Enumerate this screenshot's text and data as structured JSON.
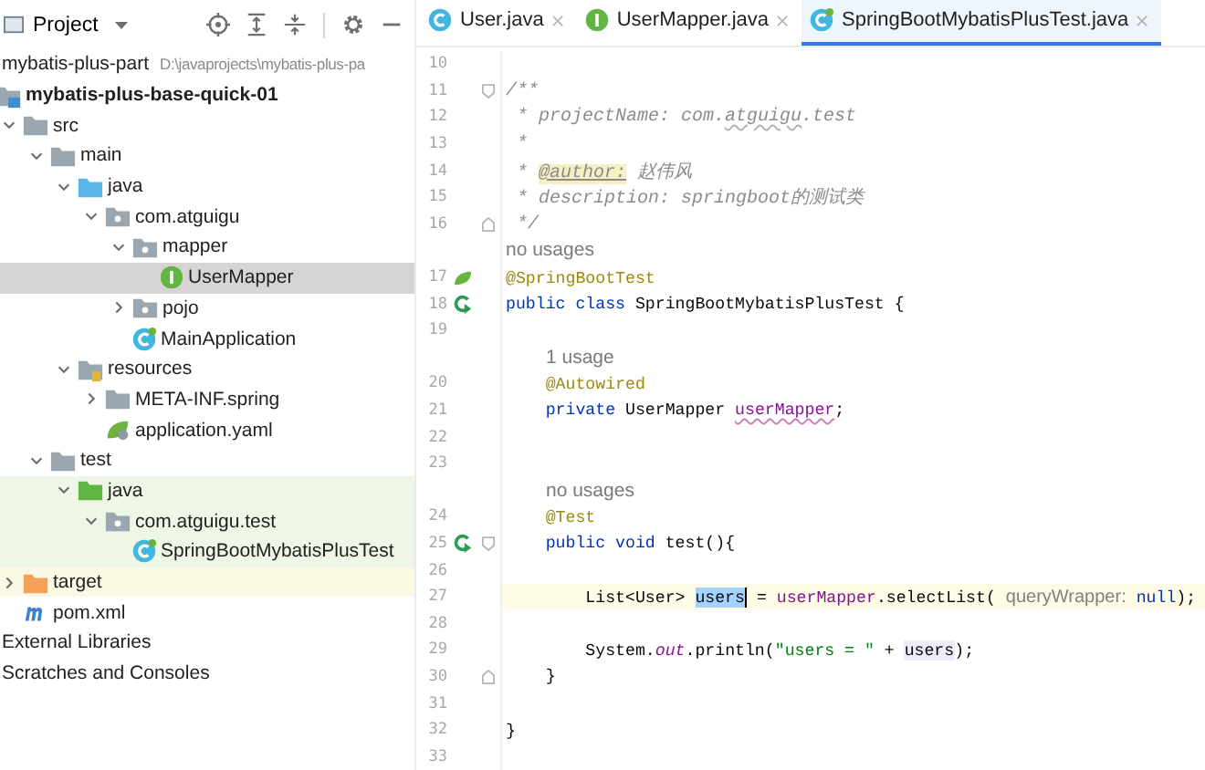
{
  "project_panel": {
    "title": "Project",
    "toolbar": [
      {
        "kind": "locate"
      },
      {
        "kind": "expand-all"
      },
      {
        "kind": "collapse-all"
      },
      {
        "kind": "settings"
      },
      {
        "kind": "hide"
      }
    ]
  },
  "tree": [
    {
      "label": "mybatis-plus-part",
      "path": "D:\\javaprojects\\mybatis-plus-pa",
      "selected": false,
      "children": [
        {
          "label": "mybatis-plus-base-quick-01",
          "kind": "module",
          "bold": true,
          "selected": false,
          "children": [
            {
              "label": "src",
              "kind": "folder",
              "expanded": true,
              "selected": false,
              "children": [
                {
                  "label": "main",
                  "kind": "folder",
                  "expanded": true,
                  "selected": false,
                  "children": [
                    {
                      "label": "java",
                      "kind": "source-folder",
                      "expanded": true,
                      "selected": false,
                      "children": [
                        {
                          "label": "com.atguigu",
                          "kind": "package",
                          "expanded": true,
                          "selected": false,
                          "children": [
                            {
                              "label": "mapper",
                              "kind": "package",
                              "expanded": true,
                              "selected": false,
                              "children": [
                                {
                                  "label": "UserMapper",
                                  "kind": "interface",
                                  "selected": true
                                }
                              ]
                            },
                            {
                              "label": "pojo",
                              "kind": "package",
                              "expanded": false,
                              "selected": false
                            },
                            {
                              "label": "MainApplication",
                              "kind": "spring-class",
                              "selected": false
                            }
                          ]
                        }
                      ]
                    },
                    {
                      "label": "resources",
                      "kind": "resources",
                      "expanded": true,
                      "selected": false,
                      "children": [
                        {
                          "label": "META-INF.spring",
                          "kind": "folder",
                          "expanded": false,
                          "selected": false
                        },
                        {
                          "label": "application.yaml",
                          "kind": "yaml",
                          "selected": false
                        }
                      ]
                    }
                  ]
                },
                {
                  "label": "test",
                  "kind": "folder",
                  "expanded": true,
                  "selected": false,
                  "children": [
                    {
                      "label": "java",
                      "kind": "test-folder",
                      "expanded": true,
                      "selected": false,
                      "test_scope": true,
                      "children": [
                        {
                          "label": "com.atguigu.test",
                          "kind": "package",
                          "expanded": true,
                          "selected": false,
                          "test_scope": true,
                          "children": [
                            {
                              "label": "SpringBootMybatisPlusTest",
                              "kind": "spring-class",
                              "selected": false,
                              "test_scope": true
                            }
                          ]
                        }
                      ]
                    }
                  ]
                }
              ]
            },
            {
              "label": "target",
              "kind": "excluded-folder",
              "expanded": false,
              "selected": false,
              "excluded": true
            },
            {
              "label": "pom.xml",
              "kind": "maven",
              "selected": false
            }
          ]
        }
      ]
    },
    {
      "label": "External Libraries",
      "selected": false
    },
    {
      "label": "Scratches and Consoles",
      "selected": false
    }
  ],
  "tabs": [
    {
      "label": "User.java",
      "kind": "class",
      "selected": false
    },
    {
      "label": "UserMapper.java",
      "kind": "interface",
      "selected": false
    },
    {
      "label": "SpringBootMybatisPlusTest.java",
      "kind": "spring-class",
      "selected": true
    }
  ],
  "editor": {
    "lines": [
      {
        "kind": "code",
        "number": "10"
      },
      {
        "kind": "code",
        "number": "11",
        "fold": {
          "kind": "start"
        },
        "tokens": [
          {
            "text": "/**",
            "kind": "comment"
          }
        ]
      },
      {
        "kind": "code",
        "number": "12",
        "tokens": [
          {
            "text": " * projectName: com.",
            "kind": "comment"
          },
          {
            "text": "atguigu",
            "kind": "comment-typo"
          },
          {
            "text": ".test",
            "kind": "comment"
          }
        ]
      },
      {
        "kind": "code",
        "number": "13",
        "tokens": [
          {
            "text": " *",
            "kind": "comment"
          }
        ]
      },
      {
        "kind": "code",
        "number": "14",
        "tokens": [
          {
            "text": " * ",
            "kind": "comment"
          },
          {
            "text": "@author:",
            "kind": "doc-tag"
          },
          {
            "text": " 赵伟风",
            "kind": "comment"
          }
        ]
      },
      {
        "kind": "code",
        "number": "15",
        "tokens": [
          {
            "text": " * description: springboot的测试类",
            "kind": "comment"
          }
        ]
      },
      {
        "kind": "code",
        "number": "16",
        "fold": {
          "kind": "end"
        },
        "tokens": [
          {
            "text": " */",
            "kind": "comment"
          }
        ]
      },
      {
        "kind": "hint",
        "text": "no usages"
      },
      {
        "kind": "code",
        "number": "17",
        "gutter": {
          "kind": "bean"
        },
        "tokens": [
          {
            "text": "@SpringBootTest",
            "kind": "annotation"
          }
        ]
      },
      {
        "kind": "code",
        "number": "18",
        "gutter": {
          "kind": "run"
        },
        "tokens": [
          {
            "text": "public class ",
            "kind": "keyword"
          },
          {
            "text": "SpringBootMybatisPlusTest {",
            "kind": "plain"
          }
        ]
      },
      {
        "kind": "code",
        "number": "19"
      },
      {
        "kind": "hint-indented",
        "text": "1 usage"
      },
      {
        "kind": "code",
        "number": "20",
        "tokens": [
          {
            "text": "    @Autowired",
            "kind": "annotation"
          }
        ]
      },
      {
        "kind": "code",
        "number": "21",
        "tokens": [
          {
            "text": "    private ",
            "kind": "keyword"
          },
          {
            "text": "UserMapper ",
            "kind": "plain"
          },
          {
            "text": "userMapper",
            "kind": "field-typo"
          },
          {
            "text": ";",
            "kind": "plain"
          }
        ]
      },
      {
        "kind": "code",
        "number": "22"
      },
      {
        "kind": "code",
        "number": "23"
      },
      {
        "kind": "hint-indented",
        "text": "no usages"
      },
      {
        "kind": "code",
        "number": "24",
        "tokens": [
          {
            "text": "    @Test",
            "kind": "annotation"
          }
        ]
      },
      {
        "kind": "code",
        "number": "25",
        "gutter": {
          "kind": "run"
        },
        "fold": {
          "kind": "start"
        },
        "tokens": [
          {
            "text": "    public void ",
            "kind": "keyword"
          },
          {
            "text": "test(){",
            "kind": "plain"
          }
        ]
      },
      {
        "kind": "code",
        "number": "26"
      },
      {
        "kind": "code",
        "number": "27",
        "current": true,
        "tokens": [
          {
            "text": "        List<User> ",
            "kind": "plain"
          },
          {
            "text": "users",
            "kind": "selected"
          },
          {
            "text": " = ",
            "kind": "plain"
          },
          {
            "text": "userMapper",
            "kind": "field"
          },
          {
            "text": ".selectList( ",
            "kind": "plain"
          },
          {
            "text": "queryWrapper:",
            "kind": "inlay"
          },
          {
            "text": " null",
            "kind": "keyword"
          },
          {
            "text": ");",
            "kind": "plain"
          }
        ]
      },
      {
        "kind": "code",
        "number": "28"
      },
      {
        "kind": "code",
        "number": "29",
        "tokens": [
          {
            "text": "        System.",
            "kind": "plain"
          },
          {
            "text": "out",
            "kind": "static"
          },
          {
            "text": ".println(",
            "kind": "plain"
          },
          {
            "text": "\"users = \"",
            "kind": "string"
          },
          {
            "text": " + ",
            "kind": "plain"
          },
          {
            "text": "users",
            "kind": "usage"
          },
          {
            "text": ");",
            "kind": "plain"
          }
        ]
      },
      {
        "kind": "code",
        "number": "30",
        "fold": {
          "kind": "end"
        },
        "tokens": [
          {
            "text": "    }",
            "kind": "plain"
          }
        ]
      },
      {
        "kind": "code",
        "number": "31"
      },
      {
        "kind": "code",
        "number": "32",
        "tokens": [
          {
            "text": "}",
            "kind": "plain"
          }
        ]
      },
      {
        "kind": "code",
        "number": "33"
      }
    ]
  }
}
